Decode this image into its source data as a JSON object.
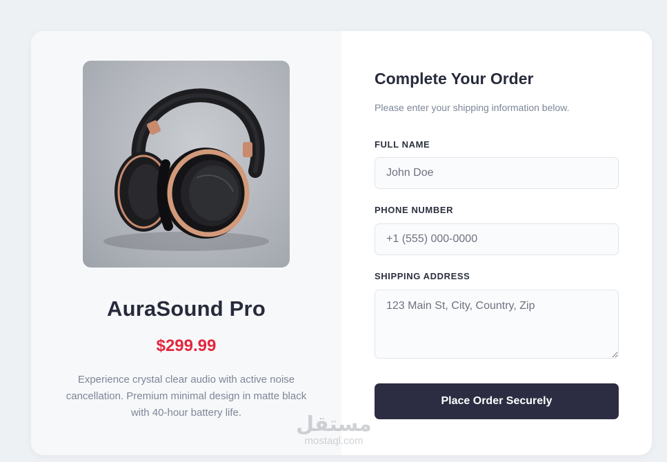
{
  "product": {
    "image_alt": "headphones",
    "name": "AuraSound Pro",
    "price": "$299.99",
    "description": "Experience crystal clear audio with active noise cancellation. Premium minimal design in matte black with 40-hour battery life."
  },
  "form": {
    "title": "Complete Your Order",
    "subtitle": "Please enter your shipping information below.",
    "full_name": {
      "label": "FULL NAME",
      "placeholder": "John Doe"
    },
    "phone": {
      "label": "PHONE NUMBER",
      "placeholder": "+1 (555) 000-0000"
    },
    "address": {
      "label": "SHIPPING ADDRESS",
      "placeholder": "123 Main St, City, Country, Zip"
    },
    "submit_label": "Place Order Securely"
  },
  "watermark": {
    "arabic": "مستقل",
    "latin": "mostaql.com"
  },
  "colors": {
    "page_bg": "#eef1f4",
    "price": "#e4263d",
    "button_bg": "#2c2d42",
    "heading": "#272a3a",
    "muted": "#7c8696"
  }
}
